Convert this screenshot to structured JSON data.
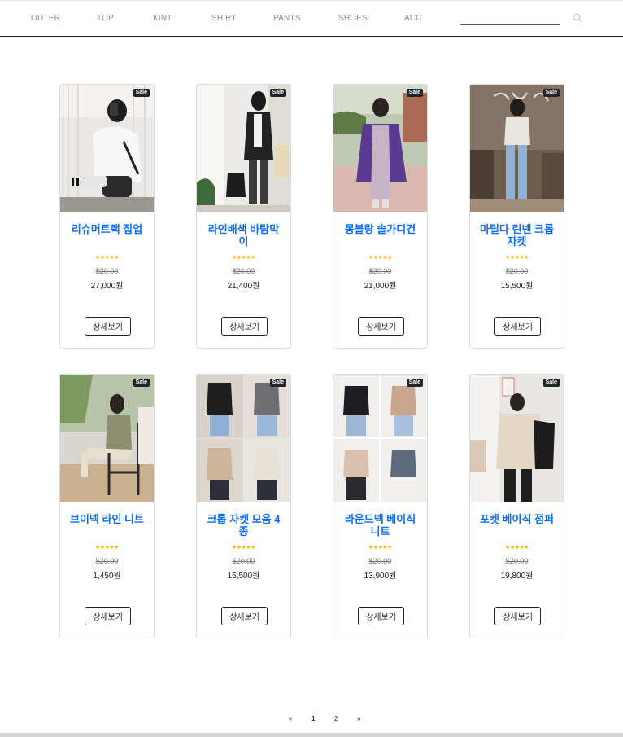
{
  "nav": {
    "items": [
      "OUTER",
      "TOP",
      "KINT",
      "SHIRT",
      "PANTS",
      "SHOES",
      "ACC"
    ],
    "search_placeholder": ""
  },
  "products": [
    {
      "name": "리슈머트랙 집업",
      "badge": "Sale",
      "stars": "★★★★★",
      "old_price": "$20.00",
      "price": "27,000원",
      "button": "상세보기"
    },
    {
      "name": "라인배색 바람막이",
      "badge": "Sale",
      "stars": "★★★★★",
      "old_price": "$20.00",
      "price": "21,400원",
      "button": "상세보기"
    },
    {
      "name": "몽블랑 솔가디건",
      "badge": "Sale",
      "stars": "★★★★★",
      "old_price": "$20.00",
      "price": "21,000원",
      "button": "상세보기"
    },
    {
      "name": "마틸다 린넨 크롭자켓",
      "badge": "Sale",
      "stars": "★★★★★",
      "old_price": "$20.00",
      "price": "15,500원",
      "button": "상세보기"
    },
    {
      "name": "브이넥 라인 니트",
      "badge": "Sale",
      "stars": "★★★★★",
      "old_price": "$20.00",
      "price": "1,450원",
      "button": "상세보기"
    },
    {
      "name": "크롭 자켓 모음 4종",
      "badge": "Sale",
      "stars": "★★★★★",
      "old_price": "$20.00",
      "price": "15,500원",
      "button": "상세보기"
    },
    {
      "name": "라운드넥 베이직 니트",
      "badge": "Sale",
      "stars": "★★★★★",
      "old_price": "$20.00",
      "price": "13,900원",
      "button": "상세보기"
    },
    {
      "name": "포켓 베이직 점퍼",
      "badge": "Sale",
      "stars": "★★★★★",
      "old_price": "$20.00",
      "price": "19,800원",
      "button": "상세보기"
    }
  ],
  "pagination": {
    "prev": "«",
    "pages": [
      "1",
      "2"
    ],
    "next": "»"
  },
  "colors": {
    "title": "#0d6efd",
    "stars": "#f5b400",
    "badge": "#212529"
  }
}
